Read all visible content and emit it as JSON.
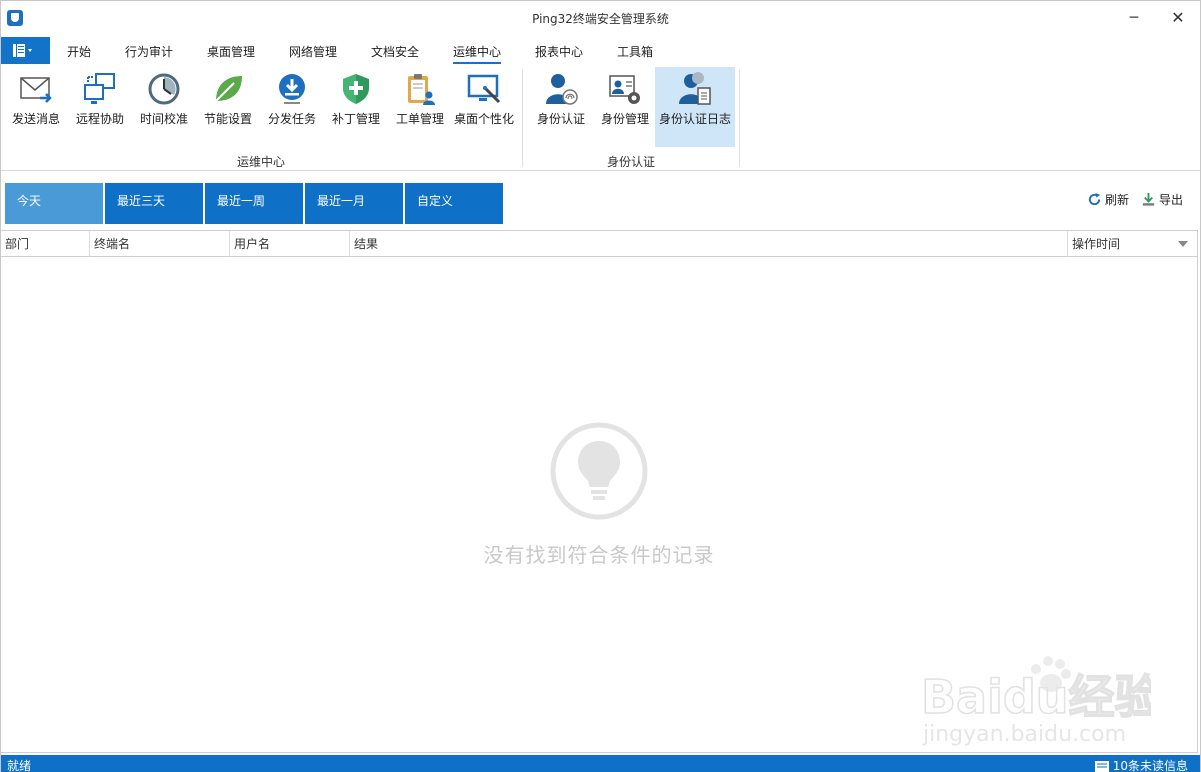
{
  "window": {
    "title": "Ping32终端安全管理系统"
  },
  "menu": {
    "tabs": [
      "开始",
      "行为审计",
      "桌面管理",
      "网络管理",
      "文档安全",
      "运维中心",
      "报表中心",
      "工具箱"
    ],
    "active": "运维中心"
  },
  "ribbon": {
    "groups": [
      {
        "label": "运维中心",
        "buttons": [
          "发送消息",
          "远程协助",
          "时间校准",
          "节能设置",
          "分发任务",
          "补丁管理",
          "工单管理",
          "桌面个性化"
        ]
      },
      {
        "label": "身份认证",
        "buttons": [
          "身份认证",
          "身份管理",
          "身份认证日志"
        ]
      }
    ],
    "selected": "身份认证日志"
  },
  "filters": {
    "tabs": [
      "今天",
      "最近三天",
      "最近一周",
      "最近一月",
      "自定义"
    ],
    "active": "今天"
  },
  "toolbar": {
    "refresh": "刷新",
    "export": "导出"
  },
  "grid": {
    "columns": [
      "部门",
      "终端名",
      "用户名",
      "结果",
      "操作时间"
    ],
    "rows": [],
    "empty_message": "没有找到符合条件的记录"
  },
  "watermark": {
    "brand": "Baidu经验",
    "url": "jingyan.baidu.com"
  },
  "statusbar": {
    "left": "就绪",
    "right": "10条未读信息"
  },
  "colors": {
    "accent": "#0f70c8",
    "accent_light": "#4a9ad8",
    "selected": "#cfe5f8"
  }
}
